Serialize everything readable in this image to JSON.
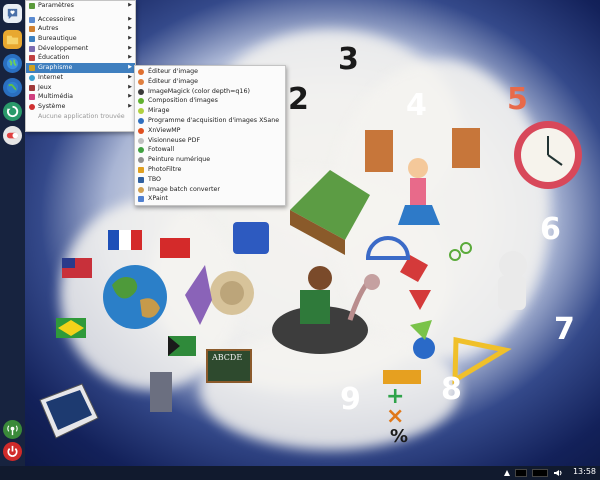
{
  "menu": {
    "items": [
      {
        "label": "Paramètres",
        "color": "#5a9a3a",
        "arrow": true
      },
      {
        "label": "Accessoires",
        "color": "#5a8ad0",
        "arrow": true
      },
      {
        "label": "Autres",
        "color": "#d08030",
        "arrow": true
      },
      {
        "label": "Bureautique",
        "color": "#3a7fc0",
        "arrow": true
      },
      {
        "label": "Développement",
        "color": "#7a6ab0",
        "arrow": true
      },
      {
        "label": "Éducation",
        "color": "#c04040",
        "arrow": true
      },
      {
        "label": "Graphisme",
        "color": "#d0a020",
        "arrow": true,
        "selected": true
      },
      {
        "label": "Internet",
        "color": "#3aa0d0",
        "arrow": true
      },
      {
        "label": "Jeux",
        "color": "#a03a3a",
        "arrow": true
      },
      {
        "label": "Multimédia",
        "color": "#d04080",
        "arrow": true
      },
      {
        "label": "Système",
        "color": "#d03030",
        "arrow": true
      },
      {
        "label": "Aucune application trouvée",
        "color": "",
        "arrow": false,
        "dim": true
      }
    ]
  },
  "submenu": {
    "items": [
      {
        "label": "Éditeur d'image",
        "color": "#e07030"
      },
      {
        "label": "Éditeur d'image",
        "color": "#e08040"
      },
      {
        "label": "ImageMagick (color depth=q16)",
        "color": "#3a3a3a"
      },
      {
        "label": "Composition d'images",
        "color": "#60b030"
      },
      {
        "label": "Mirage",
        "color": "#b0d040"
      },
      {
        "label": "Programme d'acquisition d'images XSane",
        "color": "#3070c0"
      },
      {
        "label": "XnViewMP",
        "color": "#e05020"
      },
      {
        "label": "Visionneuse PDF",
        "color": "#c0c0c0"
      },
      {
        "label": "Fotowall",
        "color": "#40a040"
      },
      {
        "label": "Peinture numérique",
        "color": "#909090"
      },
      {
        "label": "PhotoFiltre",
        "color": "#e0a020"
      },
      {
        "label": "TBO",
        "color": "#3060a0"
      },
      {
        "label": "Image batch converter",
        "color": "#d0a050"
      },
      {
        "label": "XPaint",
        "color": "#5080d0"
      }
    ]
  },
  "taskbar": {
    "clock": "13:58"
  },
  "wallpaper": {
    "numbers": [
      "2",
      "3",
      "4",
      "5",
      "6",
      "7",
      "8",
      "9"
    ],
    "math_symbols": [
      "+",
      "×",
      "%"
    ],
    "blackboard_text": "ABCDE"
  }
}
